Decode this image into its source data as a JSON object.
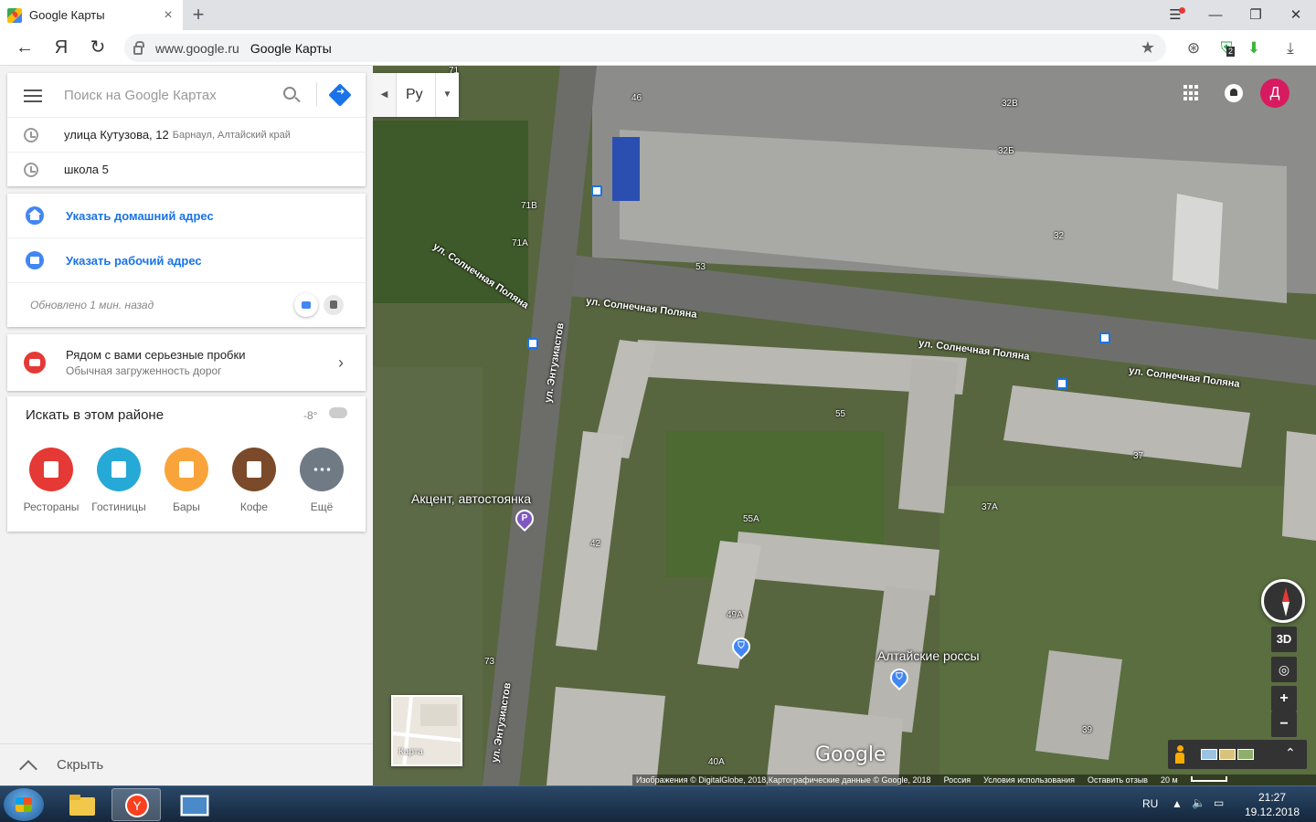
{
  "browser": {
    "tab_title": "Google Карты",
    "url_host": "www.google.ru",
    "page_title": "Google Карты",
    "tab_close": "×",
    "new_tab": "+",
    "extension_badge": "2"
  },
  "sidebar": {
    "search_placeholder": "Поиск на Google Картах",
    "history": [
      {
        "main": "улица Кутузова, 12",
        "sub": "Барнаул, Алтайский край"
      },
      {
        "main": "школа 5",
        "sub": ""
      }
    ],
    "home_label": "Указать домашний адрес",
    "work_label": "Указать рабочий адрес",
    "updated": "Обновлено 1 мин. назад",
    "traffic_title": "Рядом с вами серьезные пробки",
    "traffic_sub": "Обычная загруженность дорог",
    "explore_title": "Искать в этом районе",
    "temperature": "-8°",
    "categories": [
      {
        "name": "Рестораны",
        "color": "#e53935"
      },
      {
        "name": "Гостиницы",
        "color": "#26a9d6"
      },
      {
        "name": "Бары",
        "color": "#f9a43a"
      },
      {
        "name": "Кофе",
        "color": "#7b4a2a"
      },
      {
        "name": "Ещё",
        "color": "#6f7a85"
      }
    ],
    "hide_label": "Скрыть"
  },
  "map": {
    "language": "Ру",
    "avatar_letter": "Д",
    "minimap_label": "Карта",
    "google_logo": "Google",
    "button_3d": "3D",
    "zoom_in": "+",
    "zoom_out": "−",
    "house_numbers": [
      "71",
      "46",
      "32В",
      "32Б",
      "71В",
      "71А",
      "53",
      "32",
      "55",
      "37",
      "37А",
      "55А",
      "42",
      "49А",
      "73",
      "39",
      "40А"
    ],
    "streets": [
      "ул. Солнечная Поляна",
      "ул. Солнечная Поляна",
      "ул. Солнечная Поляна",
      "ул. Солнечная Поляна",
      "ул. Энтузиастов",
      "ул. Энтузиастов"
    ],
    "pois": [
      {
        "name": "Акцент, автостоянка",
        "pin_color": "#7e57c2",
        "pin_glyph": "P"
      },
      {
        "name": "Алтайские россы",
        "pin_color": "#4285f4",
        "pin_glyph": "⛉"
      }
    ],
    "attribution": [
      "Изображения © DigitalGlobe, 2018,Картографические данные © Google, 2018",
      "Россия",
      "Условия использования",
      "Оставить отзыв",
      "20 м"
    ]
  },
  "taskbar": {
    "language": "RU",
    "time": "21:27",
    "date": "19.12.2018"
  }
}
